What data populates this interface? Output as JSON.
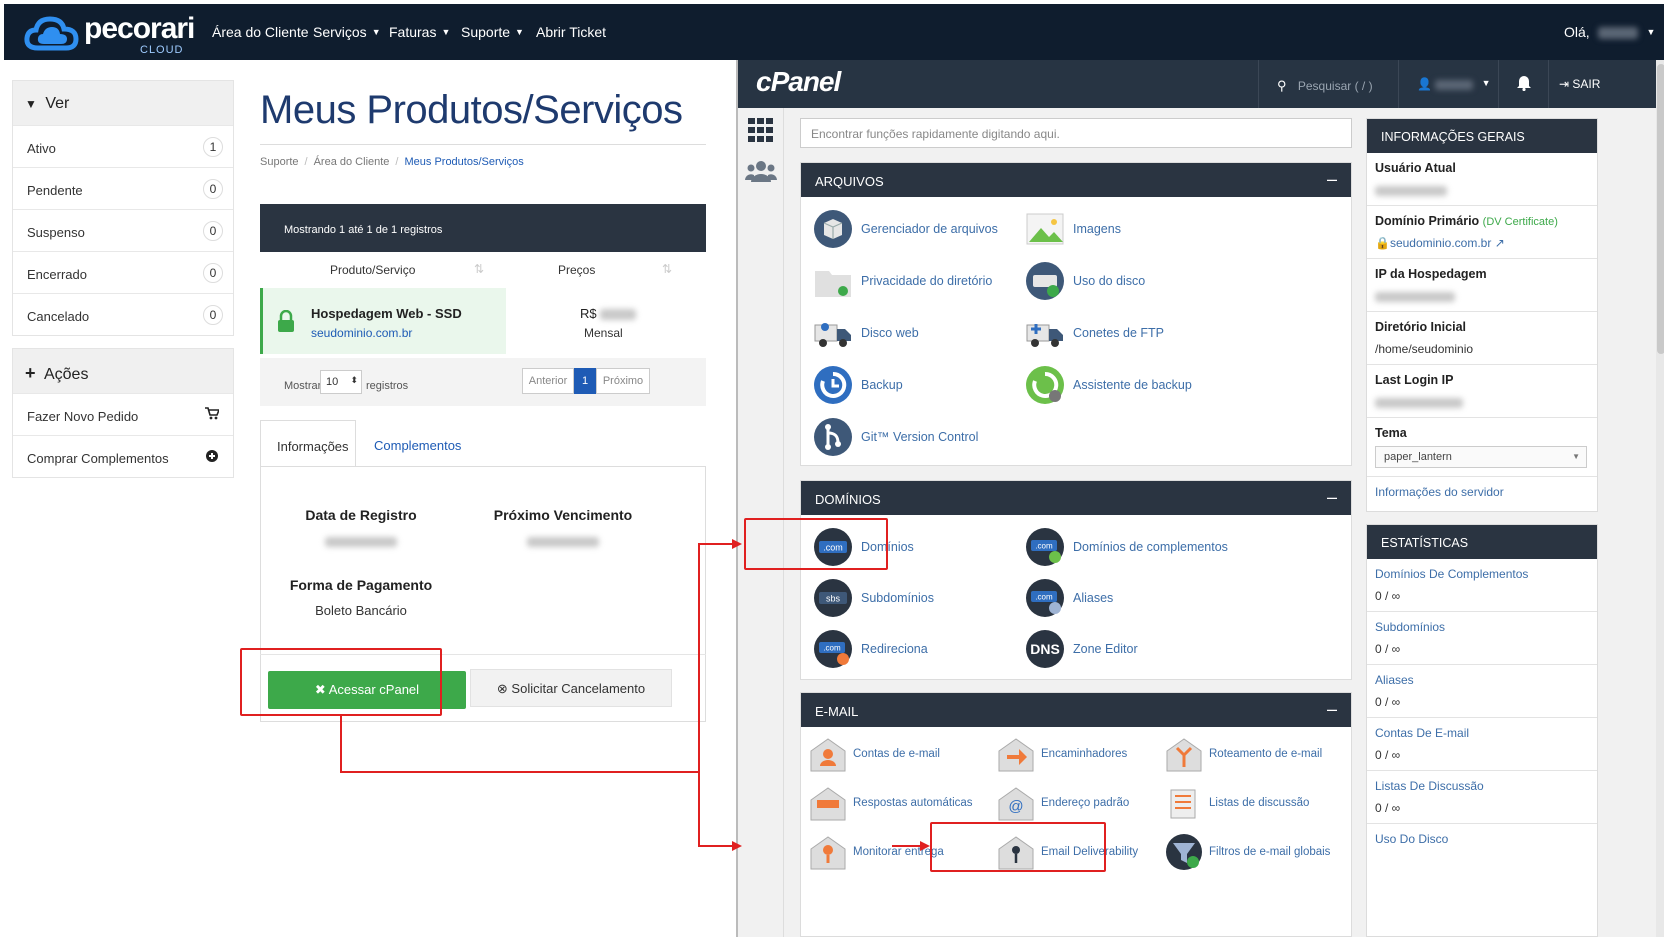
{
  "nav": {
    "brand": "pecorari",
    "brand_sub": "CLOUD",
    "items": [
      {
        "label": "Área do Cliente",
        "dropdown": false
      },
      {
        "label": "Serviços",
        "dropdown": true
      },
      {
        "label": "Faturas",
        "dropdown": true
      },
      {
        "label": "Suporte",
        "dropdown": true
      },
      {
        "label": "Abrir Ticket",
        "dropdown": false
      }
    ],
    "greeting": "Olá,"
  },
  "sidebar": {
    "filter_title": "Ver",
    "filters": [
      {
        "label": "Ativo",
        "count": "1"
      },
      {
        "label": "Pendente",
        "count": "0"
      },
      {
        "label": "Suspenso",
        "count": "0"
      },
      {
        "label": "Encerrado",
        "count": "0"
      },
      {
        "label": "Cancelado",
        "count": "0"
      }
    ],
    "actions_title": "Ações",
    "actions": [
      {
        "label": "Fazer Novo Pedido",
        "icon": "cart-icon"
      },
      {
        "label": "Comprar Complementos",
        "icon": "puzzle-icon"
      }
    ]
  },
  "main": {
    "title": "Meus Produtos/Serviços",
    "breadcrumb": [
      "Suporte",
      "Área do Cliente",
      "Meus Produtos/Serviços"
    ],
    "table_info": "Mostrando 1 até 1 de 1 registros",
    "columns": [
      "Produto/Serviço",
      "Preços"
    ],
    "row": {
      "product": "Hospedagem Web - SSD",
      "domain": "seudominio.com.br",
      "price_prefix": "R$",
      "cycle": "Mensal"
    },
    "pager": {
      "show_label": "Mostrar",
      "page_size": "10",
      "records_label": "registros",
      "prev": "Anterior",
      "page": "1",
      "next": "Próximo"
    },
    "tabs": [
      "Informações",
      "Complementos"
    ],
    "info": {
      "reg_label": "Data de Registro",
      "due_label": "Próximo Vencimento",
      "pay_label": "Forma de Pagamento",
      "pay_value": "Boleto Bancário"
    },
    "buttons": {
      "cpanel": "Acessar cPanel",
      "cancel": "Solicitar Cancelamento"
    }
  },
  "cpanel": {
    "logo": "cPanel",
    "search_placeholder": "Pesquisar ( / )",
    "logout": "SAIR",
    "quickfind_placeholder": "Encontrar funções rapidamente digitando aqui.",
    "arquivos": {
      "title": "ARQUIVOS",
      "items": [
        "Gerenciador de arquivos",
        "Imagens",
        "Privacidade do diretório",
        "Uso do disco",
        "Disco web",
        "Conetes de FTP",
        "Backup",
        "Assistente de backup",
        "Git™ Version Control"
      ]
    },
    "dominios": {
      "title": "DOMÍNIOS",
      "items": [
        "Domínios",
        "Domínios de complementos",
        "Subdomínios",
        "Aliases",
        "Redireciona",
        "Zone Editor"
      ]
    },
    "email": {
      "title": "E-MAIL",
      "items": [
        "Contas de e-mail",
        "Encaminhadores",
        "Roteamento de e-mail",
        "Respostas automáticas",
        "Endereço padrão",
        "Listas de discussão",
        "Monitorar entrega",
        "Email Deliverability",
        "Filtros de e-mail globais"
      ]
    },
    "general": {
      "title": "INFORMAÇÕES GERAIS",
      "current_user": "Usuário Atual",
      "primary_domain": "Domínio Primário",
      "dv_cert": "(DV Certificate)",
      "domain": "seudominio.com.br",
      "host_ip": "IP da Hospedagem",
      "home_dir": "Diretório Inicial",
      "home_dir_value": "/home/seudominio",
      "last_login": "Last Login IP",
      "theme": "Tema",
      "theme_value": "paper_lantern",
      "server_info": "Informações do servidor"
    },
    "stats": {
      "title": "ESTATÍSTICAS",
      "items": [
        {
          "label": "Domínios De Complementos",
          "value": "0 / ∞"
        },
        {
          "label": "Subdomínios",
          "value": "0 / ∞"
        },
        {
          "label": "Aliases",
          "value": "0 / ∞"
        },
        {
          "label": "Contas De E-mail",
          "value": "0 / ∞"
        },
        {
          "label": "Listas De Discussão",
          "value": "0 / ∞"
        },
        {
          "label": "Uso Do Disco",
          "value": ""
        }
      ]
    }
  },
  "colors": {
    "nav_bg": "#0f1d2e",
    "accent_green": "#3da94a",
    "link_blue": "#1e5bb5",
    "cpanel_header": "#273443",
    "panel_header": "#2a3441",
    "annotation_red": "#e02020"
  }
}
